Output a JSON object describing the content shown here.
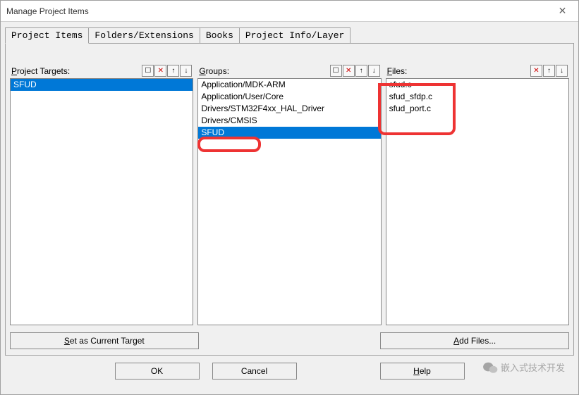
{
  "window": {
    "title": "Manage Project Items"
  },
  "tabs": {
    "project_items": "Project Items",
    "folders_ext": "Folders/Extensions",
    "books": "Books",
    "project_info": "Project Info/Layer"
  },
  "columns": {
    "targets": {
      "label_pre": "",
      "label_u": "P",
      "label_post": "roject Targets:",
      "items": [
        "SFUD"
      ],
      "selectedIndex": 0,
      "button": "Set as Current Target",
      "button_u": "S"
    },
    "groups": {
      "label_pre": "",
      "label_u": "G",
      "label_post": "roups:",
      "items": [
        "Application/MDK-ARM",
        "Application/User/Core",
        "Drivers/STM32F4xx_HAL_Driver",
        "Drivers/CMSIS",
        "SFUD"
      ],
      "selectedIndex": 4
    },
    "files": {
      "label_pre": "",
      "label_u": "F",
      "label_post": "iles:",
      "items": [
        "sfud.c",
        "sfud_sfdp.c",
        "sfud_port.c"
      ],
      "selectedIndex": -1,
      "button": "Add Files...",
      "button_u": "A"
    }
  },
  "icons": {
    "new": "☐",
    "delete": "✕",
    "up": "↑",
    "down": "↓"
  },
  "buttons": {
    "ok": "OK",
    "cancel": "Cancel",
    "help": "Help",
    "help_u": "H"
  },
  "watermark": "嵌入式技术开发"
}
